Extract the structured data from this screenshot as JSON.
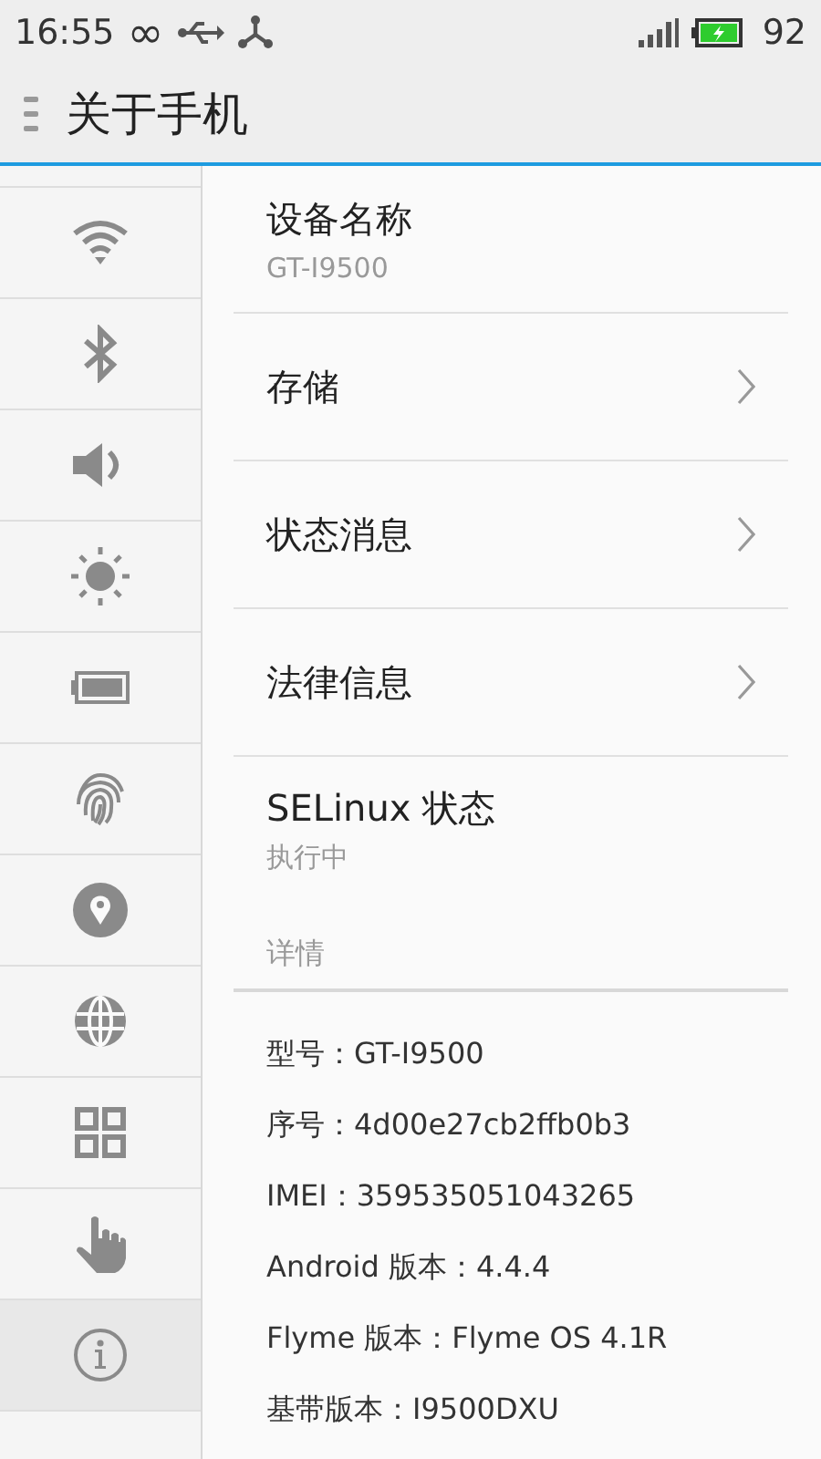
{
  "status_bar": {
    "time": "16:55",
    "loop_glyph": "∞",
    "battery_percent": "92"
  },
  "title_bar": {
    "title": "关于手机"
  },
  "sidebar": {
    "items": [
      {
        "kind": "wifi",
        "selected": false
      },
      {
        "kind": "bluetooth",
        "selected": false
      },
      {
        "kind": "sound",
        "selected": false
      },
      {
        "kind": "brightness",
        "selected": false
      },
      {
        "kind": "battery",
        "selected": false
      },
      {
        "kind": "fingerprint",
        "selected": false
      },
      {
        "kind": "location",
        "selected": false
      },
      {
        "kind": "globe",
        "selected": false
      },
      {
        "kind": "apps",
        "selected": false
      },
      {
        "kind": "gesture",
        "selected": false
      },
      {
        "kind": "info",
        "selected": true
      }
    ]
  },
  "settings": [
    {
      "title": "设备名称",
      "subtitle": "GT-I9500",
      "chevron": false
    },
    {
      "title": "存储",
      "chevron": true
    },
    {
      "title": "状态消息",
      "chevron": true
    },
    {
      "title": "法律信息",
      "chevron": true
    },
    {
      "title": "SELinux 状态",
      "subtitle": "执行中",
      "chevron": false
    }
  ],
  "details": {
    "header": "详情",
    "lines": [
      "型号：GT-I9500",
      "序号：4d00e27cb2ffb0b3",
      "IMEI：359535051043265",
      "Android 版本：4.4.4",
      "Flyme 版本：Flyme OS 4.1R",
      "基带版本：I9500DXU"
    ]
  }
}
